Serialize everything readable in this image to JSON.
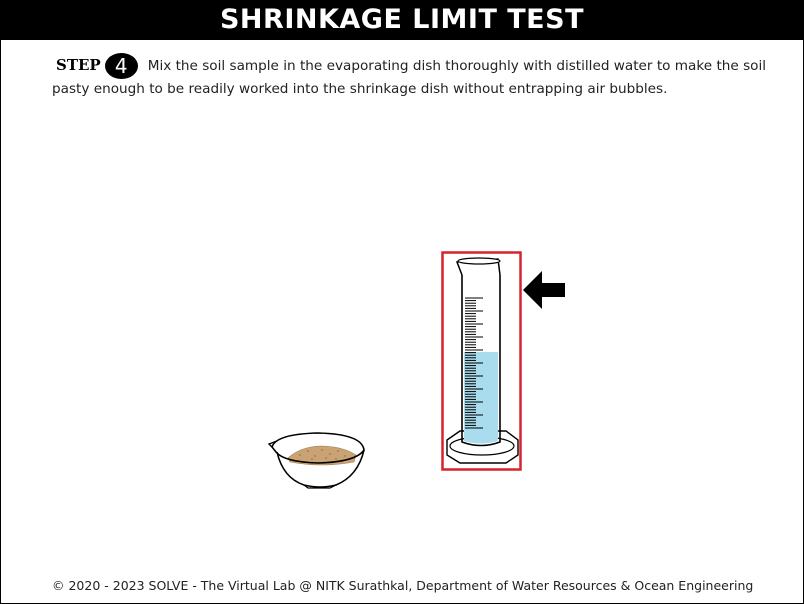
{
  "header": {
    "title": "SHRINKAGE LIMIT TEST"
  },
  "step": {
    "label": "STEP",
    "number": "4",
    "instruction": "Mix the soil sample in the evaporating dish thoroughly with distilled water to make the soil pasty enough to be readily worked into the shrinkage dish without entrapping air bubbles."
  },
  "scene": {
    "items": [
      "evaporating-dish",
      "measuring-cylinder",
      "pointer-arrow"
    ],
    "cylinder_fill_fraction": 0.55,
    "colors": {
      "water": "#a9dcec",
      "soil": "#c9a374",
      "highlight": "#d6232c"
    }
  },
  "footer": {
    "text": "© 2020 - 2023 SOLVE - The Virtual Lab @ NITK Surathkal, Department of Water Resources & Ocean Engineering"
  }
}
